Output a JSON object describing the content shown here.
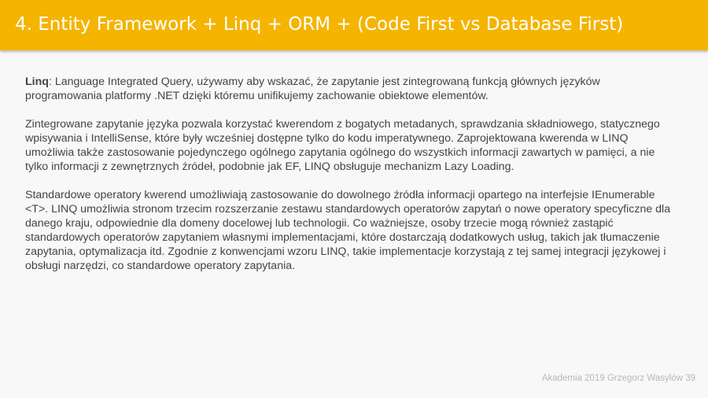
{
  "header": {
    "title": "4. Entity Framework + Linq + ORM + (Code First vs Database First)"
  },
  "content": {
    "p1_term": "Linq",
    "p1_text": ": Language Integrated Query, używamy aby wskazać, że zapytanie jest zintegrowaną funkcją głównych języków programowania platformy .NET dzięki któremu unifikujemy zachowanie obiektowe elementów.",
    "p2": "Zintegrowane zapytanie języka pozwala korzystać kwerendom z bogatych metadanych, sprawdzania składniowego, statycznego wpisywania i IntelliSense, które były wcześniej dostępne tylko do kodu imperatywnego. Zaprojektowana kwerenda w LINQ umożliwia także zastosowanie pojedynczego ogólnego zapytania ogólnego do wszystkich informacji zawartych w pamięci, a nie tylko informacji z zewnętrznych źródeł, podobnie jak EF, LINQ obsługuje mechanizm Lazy Loading.",
    "p3": "Standardowe operatory kwerend umożliwiają zastosowanie do dowolnego źródła informacji opartego na interfejsie IEnumerable <T>. LINQ umożliwia stronom trzecim rozszerzanie zestawu standardowych operatorów zapytań o nowe operatory specyficzne dla danego kraju, odpowiednie dla domeny docelowej lub technologii. Co ważniejsze, osoby trzecie mogą również zastąpić standardowych operatorów zapytaniem własnymi implementacjami, które dostarczają dodatkowych usług, takich jak tłumaczenie zapytania, optymalizacja itd. Zgodnie z konwencjami wzoru LINQ, takie implementacje korzystają z tej samej integracji językowej i obsługi narzędzi, co standardowe operatory zapytania."
  },
  "footer": {
    "text": "Akademia 2019 Grzegorz Wasylów 39"
  }
}
